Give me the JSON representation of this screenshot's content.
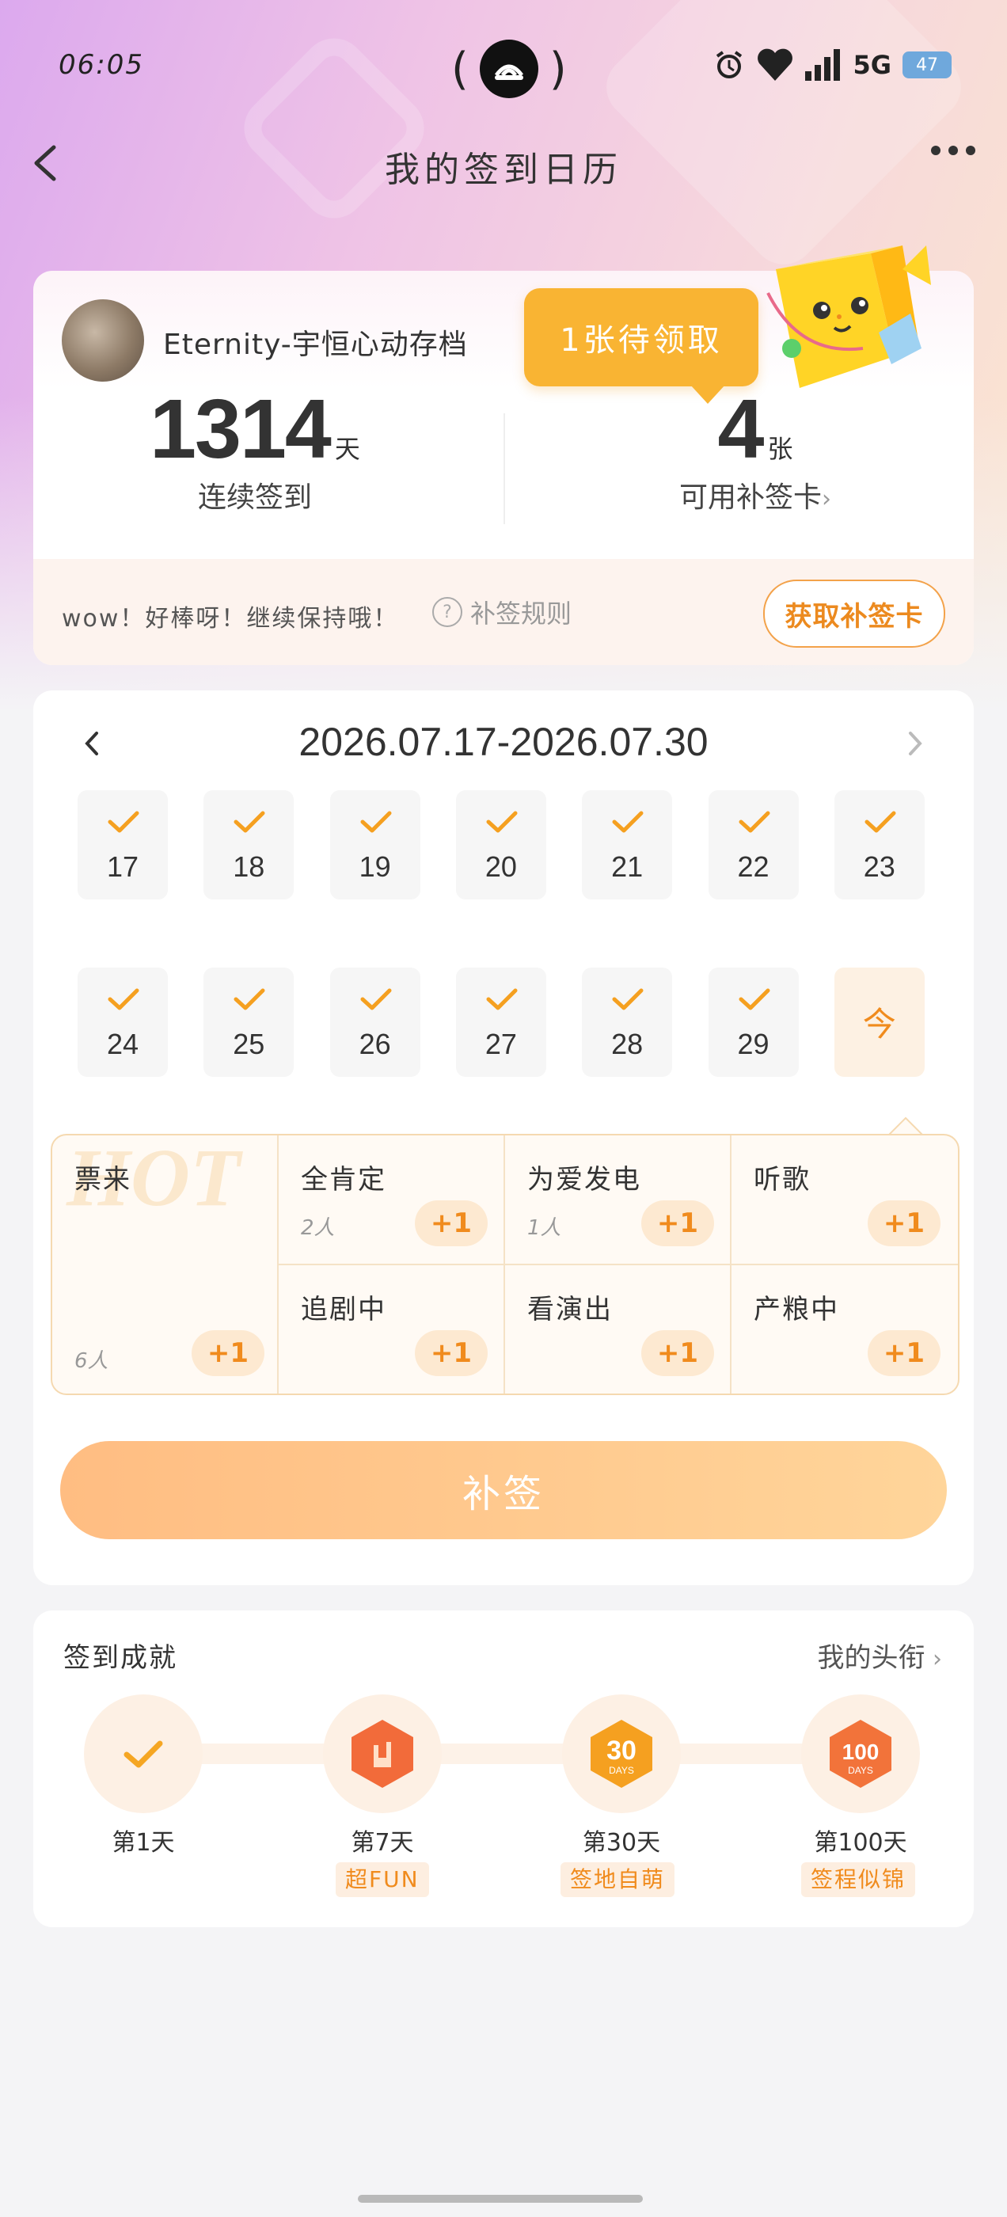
{
  "status_bar": {
    "time": "06:05",
    "network": "5G",
    "battery": "47"
  },
  "header": {
    "title": "我的签到日历"
  },
  "profile": {
    "username": "Eternity-宇恒心动存档"
  },
  "pending_badge": "1张待领取",
  "stats": {
    "streak_value": "1314",
    "streak_unit": "天",
    "streak_label": "连续签到",
    "cards_value": "4",
    "cards_unit": "张",
    "cards_label": "可用补签卡"
  },
  "encourage": {
    "message": "wow！好棒呀！继续保持哦！",
    "rules_label": "补签规则",
    "get_card_label": "获取补签卡"
  },
  "calendar": {
    "range": "2026.07.17-2026.07.30",
    "days": [
      {
        "label": "17",
        "checked": true
      },
      {
        "label": "18",
        "checked": true
      },
      {
        "label": "19",
        "checked": true
      },
      {
        "label": "20",
        "checked": true
      },
      {
        "label": "21",
        "checked": true
      },
      {
        "label": "22",
        "checked": true
      },
      {
        "label": "23",
        "checked": true
      },
      {
        "label": "24",
        "checked": true
      },
      {
        "label": "25",
        "checked": true
      },
      {
        "label": "26",
        "checked": true
      },
      {
        "label": "27",
        "checked": true
      },
      {
        "label": "28",
        "checked": true
      },
      {
        "label": "29",
        "checked": true
      },
      {
        "label": "今",
        "checked": false
      }
    ]
  },
  "topics": {
    "watermark": "HOT",
    "plus_label": "+1",
    "featured": {
      "name": "票来",
      "count": "6人"
    },
    "items": [
      {
        "name": "全肯定",
        "count": "2人"
      },
      {
        "name": "为爱发电",
        "count": "1人"
      },
      {
        "name": "听歌",
        "count": ""
      },
      {
        "name": "追剧中",
        "count": ""
      },
      {
        "name": "看演出",
        "count": ""
      },
      {
        "name": "产粮中",
        "count": ""
      }
    ]
  },
  "makeup_button": "补签",
  "achievements": {
    "title": "签到成就",
    "link": "我的头衔",
    "items": [
      {
        "label": "第1天",
        "tag": ""
      },
      {
        "label": "第7天",
        "tag": "超FUN"
      },
      {
        "label": "第30天",
        "tag": "签地自萌"
      },
      {
        "label": "第100天",
        "tag": "签程似锦"
      }
    ],
    "badge_marks": [
      "30",
      "DAYS",
      "100",
      "DAYS"
    ]
  },
  "colors": {
    "accent": "#f08b1d",
    "pending": "#f9b433",
    "button": "#ffc98c"
  }
}
